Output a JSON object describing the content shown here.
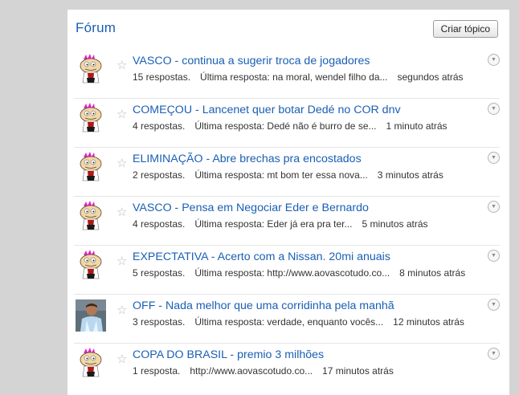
{
  "forum": {
    "title": "Fórum",
    "new_topic_label": "Criar tópico"
  },
  "topics": [
    {
      "title": "VASCO - continua a sugerir troca de jogadores",
      "replies": "15 respostas.",
      "last_reply": "Última resposta: na moral, wendel filho da...",
      "time": "segundos atrás",
      "avatar": "cartoon-avatar"
    },
    {
      "title": "COMEÇOU - Lancenet quer botar Dedé no COR dnv",
      "replies": "4 respostas.",
      "last_reply": "Última resposta: Dedé não é burro de se...",
      "time": "1 minuto atrás",
      "avatar": "cartoon-avatar"
    },
    {
      "title": "ELIMINAÇÃO - Abre brechas pra encostados",
      "replies": "2 respostas.",
      "last_reply": "Última resposta: mt bom ter essa nova...",
      "time": "3 minutos atrás",
      "avatar": "cartoon-avatar"
    },
    {
      "title": "VASCO - Pensa em Negociar Eder e Bernardo",
      "replies": "4 respostas.",
      "last_reply": "Última resposta: Eder já era pra ter...",
      "time": "5 minutos atrás",
      "avatar": "cartoon-avatar"
    },
    {
      "title": "EXPECTATIVA - Acerto com a Nissan. 20mi anuais",
      "replies": "5 respostas.",
      "last_reply": "Última resposta: http://www.aovascotudo.co...",
      "time": "8 minutos atrás",
      "avatar": "cartoon-avatar"
    },
    {
      "title": "OFF - Nada melhor que uma corridinha pela manhã",
      "replies": "3 respostas.",
      "last_reply": "Última resposta: verdade, enquanto vocês...",
      "time": "12 minutos atrás",
      "avatar": "photo-avatar"
    },
    {
      "title": "COPA DO BRASIL - premio 3 milhões",
      "replies": "1 resposta.",
      "last_reply": "http://www.aovascotudo.co...",
      "time": "17 minutos atrás",
      "avatar": "cartoon-avatar"
    }
  ],
  "icons": {
    "star": "star-outline-icon",
    "menu": "chevron-down-circle-icon"
  },
  "colors": {
    "link": "#1a5fb4",
    "background": "#d4d4d4",
    "panel": "#ffffff"
  }
}
